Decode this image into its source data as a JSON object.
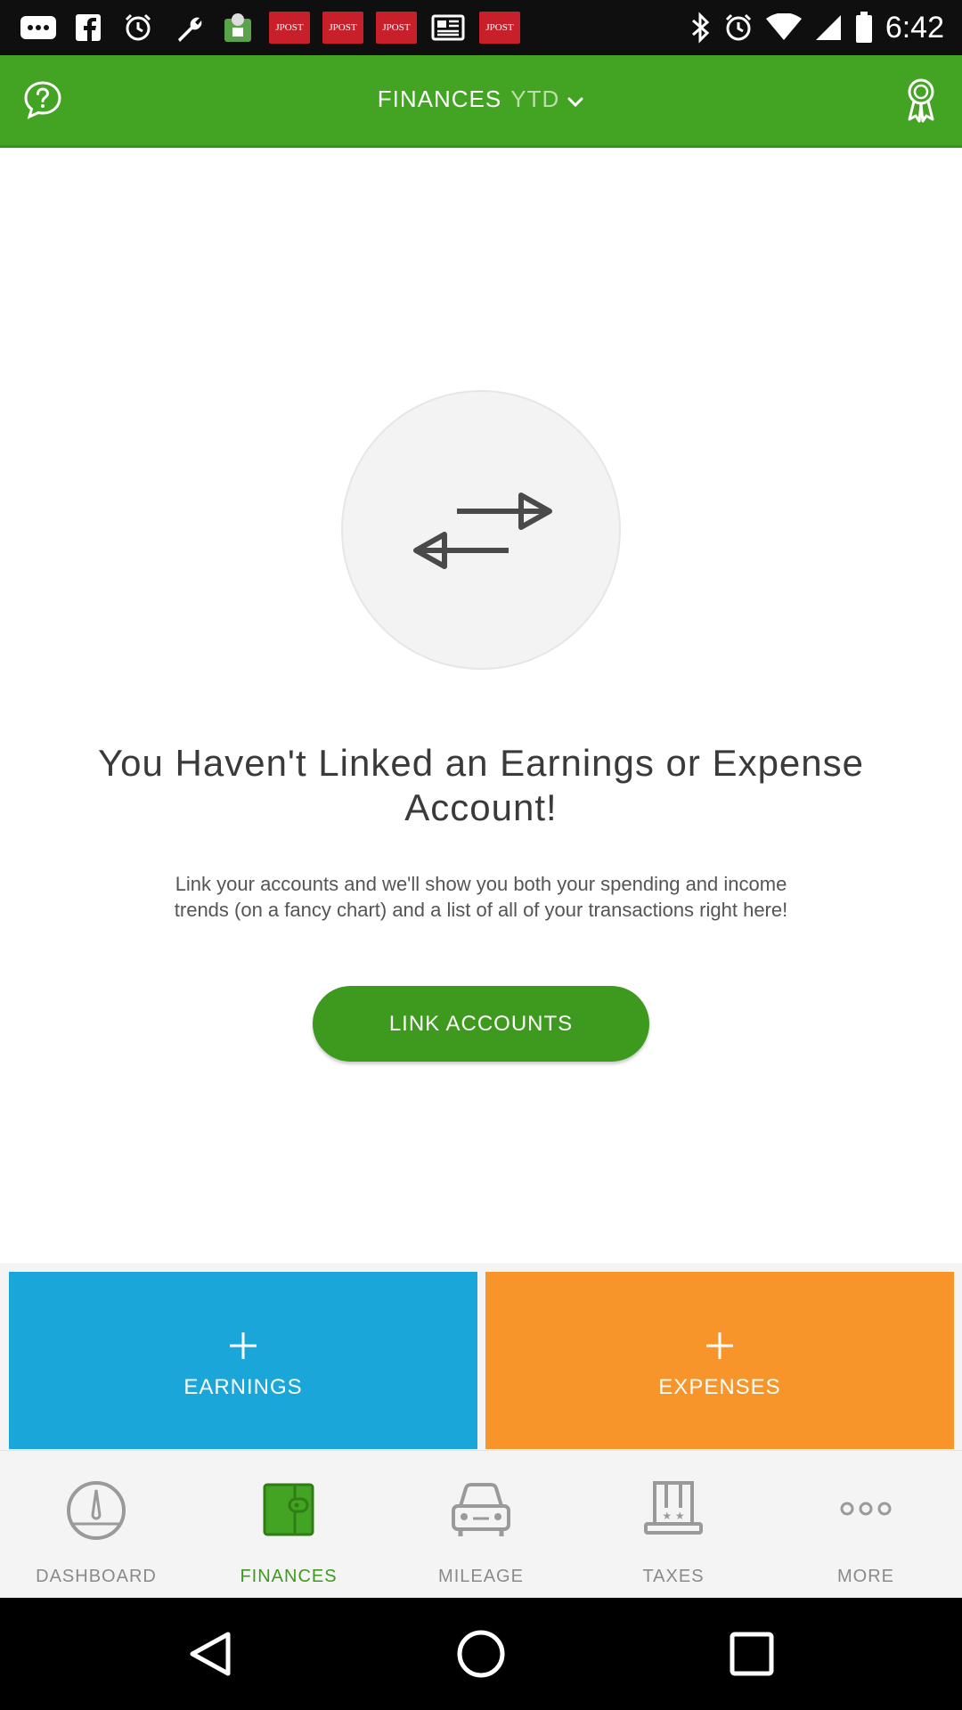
{
  "status_bar": {
    "time": "6:42",
    "notification_icons": [
      "more-dots-icon",
      "facebook-icon",
      "alarm-icon",
      "wrench-icon",
      "green-app-icon",
      "jpost-icon",
      "jpost-icon",
      "jpost-icon",
      "news-icon",
      "jpost-icon"
    ],
    "jpost_label": "JPOST",
    "system_icons": [
      "bluetooth-icon",
      "alarm-icon",
      "wifi-icon",
      "signal-icon",
      "battery-icon"
    ]
  },
  "header": {
    "title": "FINANCES",
    "period": "YTD",
    "colors": {
      "bar": "#43a322",
      "period_text": "#b9e0a6"
    }
  },
  "empty_state": {
    "title": "You Haven't Linked an Earnings or Expense Account!",
    "description": "Link your accounts and we'll show you both your spending and income trends (on a fancy chart) and a list of all of your transactions right here!",
    "button_label": "LINK ACCOUNTS"
  },
  "tiles": {
    "earnings": {
      "label": "EARNINGS",
      "color": "#1aa6d9"
    },
    "expenses": {
      "label": "EXPENSES",
      "color": "#f7952a"
    }
  },
  "bottom_nav": {
    "items": [
      {
        "label": "DASHBOARD",
        "icon": "gauge-icon"
      },
      {
        "label": "FINANCES",
        "icon": "wallet-icon",
        "active": true
      },
      {
        "label": "MILEAGE",
        "icon": "car-icon"
      },
      {
        "label": "TAXES",
        "icon": "hat-icon"
      },
      {
        "label": "MORE",
        "icon": "more-dots-icon"
      }
    ],
    "active_color": "#3e9a1e"
  }
}
